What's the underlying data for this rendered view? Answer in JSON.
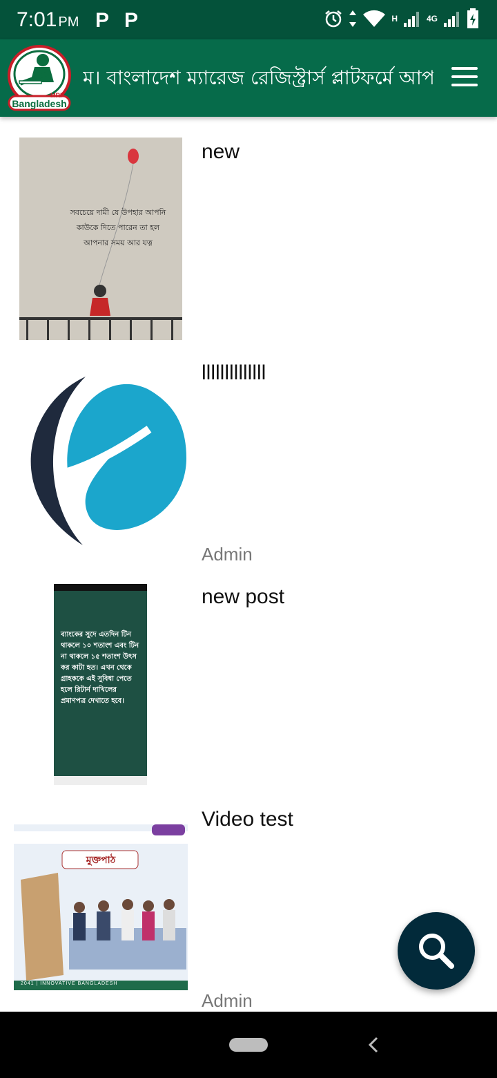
{
  "status_bar": {
    "time": "7:01",
    "ampm": "PM",
    "notif_1": "P",
    "notif_2": "P",
    "net_h": "H",
    "net_4g": "4G",
    "icons": [
      "alarm-icon",
      "data-arrows-icon",
      "wifi-icon",
      "signal-icon",
      "battery-charging-icon"
    ]
  },
  "app_bar": {
    "logo_text": "Bangladesh",
    "logo_badge": "MRP",
    "title": "ম। বাংলাদেশ ম্যারেজ রেজিস্ট্রার্স প্লাটফর্মে আপনাকে স্বাগতম",
    "menu_icon": "hamburger-menu-icon"
  },
  "posts": [
    {
      "title": "new",
      "author": "",
      "image_text": "সবচেয়ে দামী যে উপহার আপনি কাউকে দিতে পারেন তা হল আপনার সময় আর যত্ন"
    },
    {
      "title": "llllllllllllll",
      "author": "Admin",
      "image_text": ""
    },
    {
      "title": "new post",
      "author": "",
      "image_text": "ব্যাংকের সুদে এতদিন টিন থাকলে ১০ শতাংশ এবং টিন না থাকলে ১৫ শতাংশ উৎস কর কাটা হত। এখন থেকে গ্রাহককে এই সুবিধা পেতে হলে রিটার্ন দাখিলের প্রমাণপত্র দেখাতে হবে।"
    },
    {
      "title": "Video test",
      "author": "Admin",
      "image_text": "মুক্তপাঠ",
      "image_footer": "2041 | INNOVATIVE BANGLADESH"
    }
  ],
  "fab": {
    "icon": "search-icon"
  },
  "colors": {
    "status_bar": "#04523a",
    "app_bar": "#066b4a",
    "fab": "#022a3a",
    "logo_blue": "#1ba6cc",
    "logo_dark": "#1f2a3d"
  }
}
